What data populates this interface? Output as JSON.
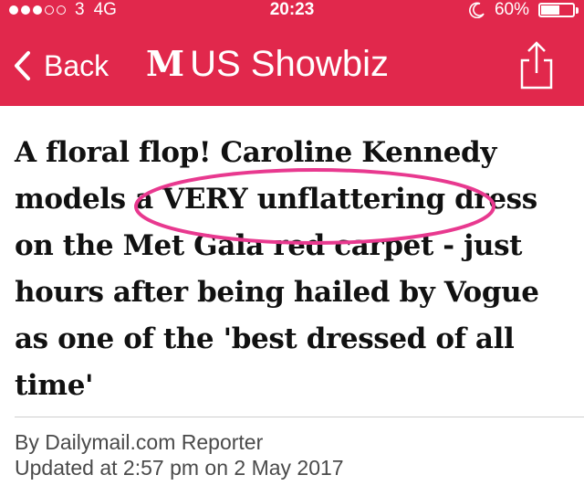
{
  "status_bar": {
    "carrier": "3",
    "network": "4G",
    "time": "20:23",
    "battery": "60%",
    "battery_level": 0.6,
    "signal_bars_filled": 3,
    "signal_bars_total": 5
  },
  "nav": {
    "back_label": "Back",
    "logo_text": "M",
    "section_title": "US Showbiz"
  },
  "article": {
    "headline": "A floral flop! Caroline Kennedy models a VERY unflattering dress on the Met Gala red carpet - just hours after being hailed by Vogue as one of the 'best dressed of all time'",
    "byline": "By Dailymail.com Reporter",
    "updated": "Updated at 2:57 pm on 2 May 2017"
  },
  "colors": {
    "brand_red": "#e1284c",
    "annotation_pink": "#e8398f",
    "headline": "#111111",
    "meta_text": "#4a4a4a"
  },
  "icons": {
    "back": "chevron-left-icon",
    "share": "share-icon",
    "do_not_disturb": "moon-icon",
    "battery": "battery-icon"
  }
}
